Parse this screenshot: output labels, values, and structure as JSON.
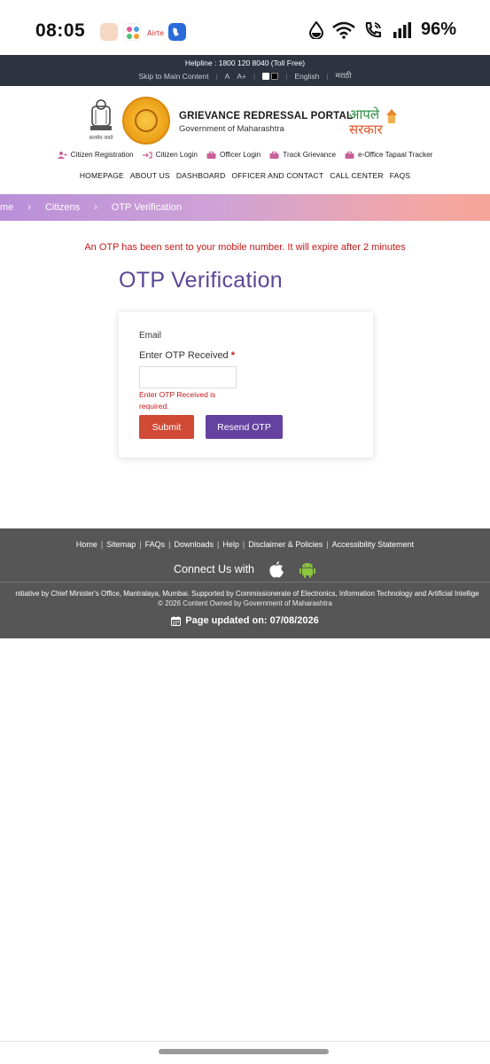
{
  "status_bar": {
    "time": "08:05",
    "battery": "96%",
    "icons": [
      "app-icon-1",
      "app-icon-2",
      "app-icon-3",
      "app-icon-4",
      "water-drop-icon",
      "wifi-icon",
      "call-icon",
      "signal-icon"
    ]
  },
  "top_strip": {
    "helpline": "Helpline : 1800 120 8040 (Toll Free)",
    "skip_link": "Skip to Main Content",
    "font_small": "A",
    "font_large": "A+",
    "lang_english": "English",
    "lang_marathi": "मराठी"
  },
  "header": {
    "title": "GRIEVANCE REDRESSAL PORTAL",
    "subtitle": "Government of Maharashtra",
    "emblem_text": "सत्यमेव जयते",
    "aaple_line1": "आपले",
    "aaple_line2": "सरकार"
  },
  "quick_links": [
    {
      "label": "Citizen Registration",
      "icon": "user-plus-icon"
    },
    {
      "label": "Citizen Login",
      "icon": "login-icon"
    },
    {
      "label": "Officer Login",
      "icon": "briefcase-icon"
    },
    {
      "label": "Track Grievance",
      "icon": "briefcase-icon"
    },
    {
      "label": "e-Office Tapaal Tracker",
      "icon": "briefcase-icon"
    }
  ],
  "main_nav": [
    "HOMEPAGE",
    "ABOUT US",
    "DASHBOARD",
    "OFFICER AND CONTACT",
    "CALL CENTER",
    "FAQS"
  ],
  "breadcrumb": [
    "me",
    "Citizens",
    "OTP Verification"
  ],
  "content": {
    "otp_message": "An OTP has been sent to your mobile number. It will expire after 2 minutes",
    "page_title": "OTP Verification"
  },
  "form": {
    "email_label": "Email",
    "otp_label": "Enter OTP Received",
    "required_mark": "*",
    "otp_value": "",
    "error": "Enter OTP Received is required.",
    "submit_label": "Submit",
    "resend_label": "Resend OTP"
  },
  "footer": {
    "links": [
      "Home",
      "Sitemap",
      "FAQs",
      "Downloads",
      "Help",
      "Disclaimer & Policies",
      "Accessibility Statement"
    ],
    "connect": "Connect Us with",
    "initiative": "nitiative by Chief Minister's Office, Mantralaya, Mumbai. Supported by Commissionerate of Electronics, Information Technology and Artificial Intellige",
    "copyright": "© 2026 Content Owned by Government of Maharashtra",
    "updated": "Page updated on: 07/08/2026"
  },
  "colors": {
    "top_strip": "#2e3340",
    "title_purple": "#5a4797",
    "error_red": "#c21a1a",
    "submit": "#d04a36",
    "resend": "#6542a0",
    "footer": "#565656"
  }
}
